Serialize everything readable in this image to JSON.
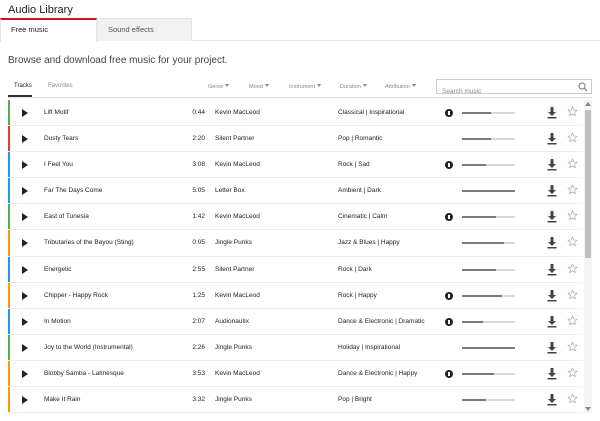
{
  "app": {
    "title": "Audio Library"
  },
  "tabs": [
    {
      "label": "Free music",
      "active": true
    },
    {
      "label": "Sound effects",
      "active": false
    }
  ],
  "subtitle": "Browse and download free music for your project.",
  "subtabs": [
    {
      "label": "Tracks",
      "active": true
    },
    {
      "label": "Favorites",
      "active": false
    }
  ],
  "filters": {
    "genre": "Genre",
    "mood": "Mood",
    "instrument": "Instrument",
    "duration": "Duration",
    "attribution": "Attribution"
  },
  "search": {
    "placeholder": "Search music",
    "value": ""
  },
  "colors": {
    "accent": "#cc181e"
  },
  "tracks": [
    {
      "title": "Lift Motif",
      "duration": "0:44",
      "artist": "Kevin MacLeod",
      "genre_mood": "Classical | Inspirational",
      "attribution": true,
      "popularity": 0.55,
      "color": "#4caf50"
    },
    {
      "title": "Dusty Tears",
      "duration": "2:20",
      "artist": "Silent Partner",
      "genre_mood": "Pop | Romantic",
      "attribution": false,
      "popularity": 0.55,
      "color": "#e53935"
    },
    {
      "title": "I Feel You",
      "duration": "3:08",
      "artist": "Kevin MacLeod",
      "genre_mood": "Rock | Sad",
      "attribution": true,
      "popularity": 0.45,
      "color": "#2196f3"
    },
    {
      "title": "Far The Days Come",
      "duration": "5:05",
      "artist": "Letter Box",
      "genre_mood": "Ambient | Dark",
      "attribution": false,
      "popularity": 1.0,
      "color": "#2196f3"
    },
    {
      "title": "East of Tunesia",
      "duration": "1:42",
      "artist": "Kevin MacLeod",
      "genre_mood": "Cinematic | Calm",
      "attribution": true,
      "popularity": 0.65,
      "color": "#4caf50"
    },
    {
      "title": "Tributaries of the Bayou (Sting)",
      "duration": "0:05",
      "artist": "Jingle Punks",
      "genre_mood": "Jazz & Blues | Happy",
      "attribution": false,
      "popularity": 0.8,
      "color": "#ff9800"
    },
    {
      "title": "Energetic",
      "duration": "2:55",
      "artist": "Silent Partner",
      "genre_mood": "Rock | Dark",
      "attribution": false,
      "popularity": 0.65,
      "color": "#2196f3"
    },
    {
      "title": "Chipper - Happy Rock",
      "duration": "1:25",
      "artist": "Kevin MacLeod",
      "genre_mood": "Rock | Happy",
      "attribution": true,
      "popularity": 0.75,
      "color": "#ff9800"
    },
    {
      "title": "In Motion",
      "duration": "2:07",
      "artist": "Audionautix",
      "genre_mood": "Dance & Electronic | Dramatic",
      "attribution": true,
      "popularity": 0.4,
      "color": "#2196f3"
    },
    {
      "title": "Joy to the World (Instrumental)",
      "duration": "2:26",
      "artist": "Jingle Punks",
      "genre_mood": "Holiday | Inspirational",
      "attribution": false,
      "popularity": 1.0,
      "color": "#4caf50"
    },
    {
      "title": "Blobby Samba - Latinesque",
      "duration": "3:53",
      "artist": "Kevin MacLeod",
      "genre_mood": "Dance & Electronic | Happy",
      "attribution": true,
      "popularity": 0.6,
      "color": "#ff9800"
    },
    {
      "title": "Make It Rain",
      "duration": "3:32",
      "artist": "Jingle Punks",
      "genre_mood": "Pop | Bright",
      "attribution": false,
      "popularity": 0.45,
      "color": "#ff9800"
    }
  ]
}
